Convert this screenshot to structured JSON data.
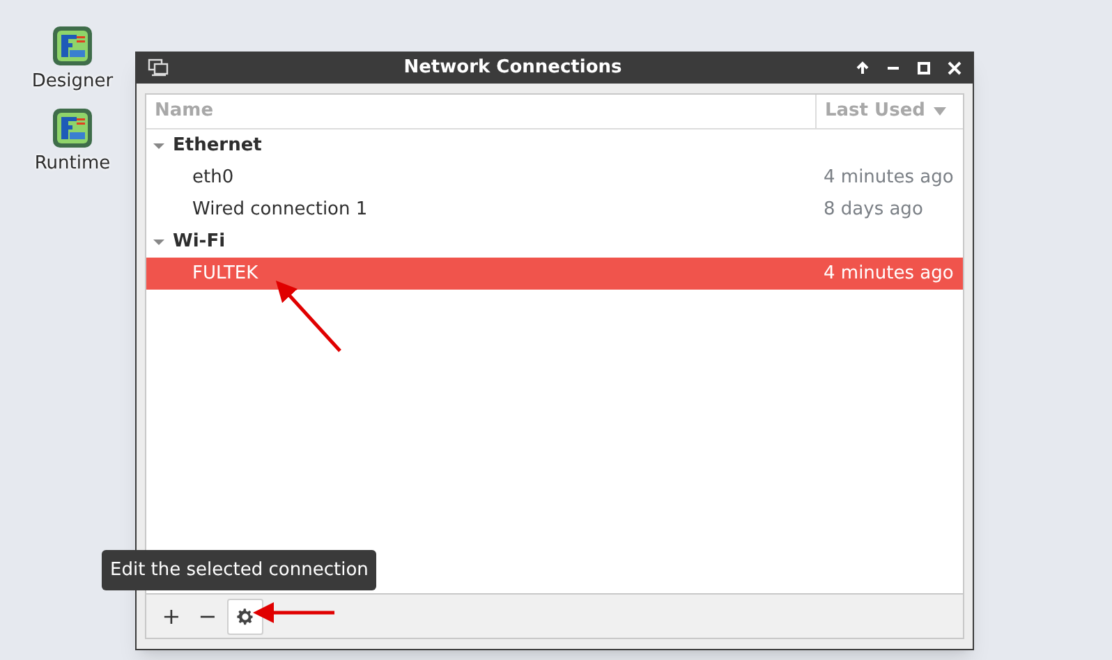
{
  "desktop_icons": [
    {
      "label": "Designer"
    },
    {
      "label": "Runtime"
    }
  ],
  "window": {
    "title": "Network Connections"
  },
  "columns": [
    {
      "label": "Name",
      "sorted": false
    },
    {
      "label": "Last Used",
      "sorted": true
    }
  ],
  "groups": [
    {
      "name": "Ethernet",
      "expanded": true,
      "children": [
        {
          "name": "eth0",
          "last_used": "4 minutes ago",
          "selected": false
        },
        {
          "name": "Wired connection 1",
          "last_used": "8 days ago",
          "selected": false
        }
      ]
    },
    {
      "name": "Wi-Fi",
      "expanded": true,
      "children": [
        {
          "name": "FULTEK",
          "last_used": "4 minutes ago",
          "selected": true
        }
      ]
    }
  ],
  "toolbar": {
    "add": "+",
    "remove": "−"
  },
  "tooltip": "Edit the selected connection"
}
